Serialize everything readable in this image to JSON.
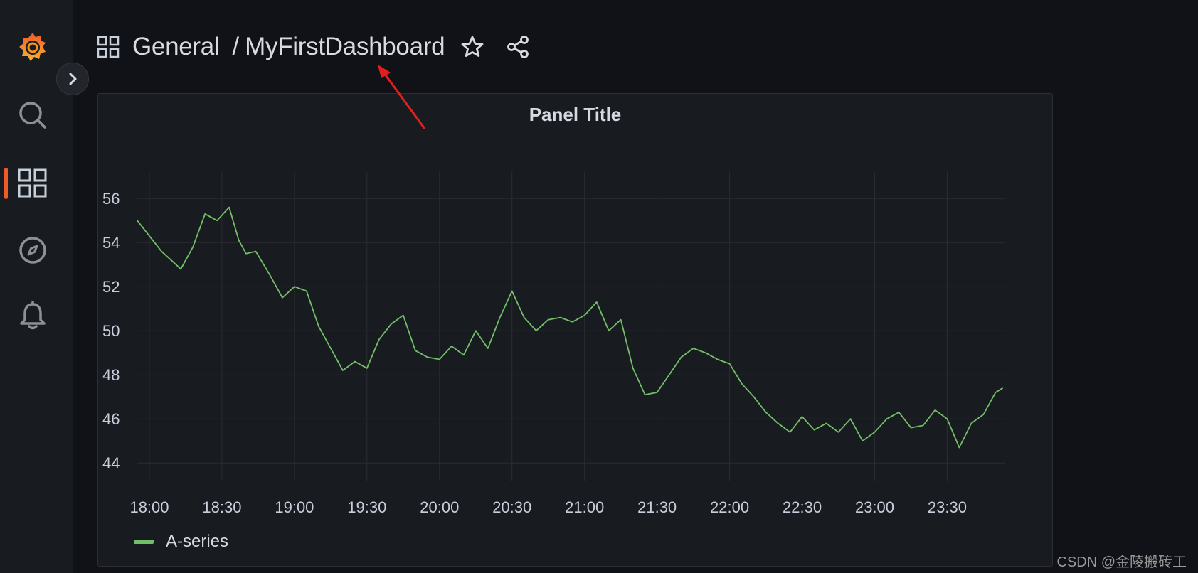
{
  "breadcrumb": {
    "folder": "General",
    "separator": "/",
    "dashboard": "MyFirstDashboard"
  },
  "sidebar": {
    "items": [
      {
        "name": "grafana-logo-icon"
      },
      {
        "name": "search-icon"
      },
      {
        "name": "dashboards-icon",
        "active": true
      },
      {
        "name": "explore-icon"
      },
      {
        "name": "alerting-bell-icon"
      }
    ]
  },
  "panel": {
    "title": "Panel Title",
    "legend": [
      {
        "label": "A-series",
        "color": "#73bf69"
      }
    ]
  },
  "chart_data": {
    "type": "line",
    "title": "Panel Title",
    "xlabel": "",
    "ylabel": "",
    "x_ticks": [
      "18:00",
      "18:30",
      "19:00",
      "19:30",
      "20:00",
      "20:30",
      "21:00",
      "21:30",
      "22:00",
      "22:30",
      "23:00",
      "23:30"
    ],
    "y_ticks": [
      44,
      46,
      48,
      50,
      52,
      56,
      54
    ],
    "ylim": [
      43.2,
      57.2
    ],
    "xlim_minutes": [
      1075,
      1434
    ],
    "grid": true,
    "legend_position": "bottom-left",
    "series": [
      {
        "name": "A-series",
        "color": "#73bf69",
        "x_minutes": [
          1075,
          1080,
          1085,
          1090,
          1093,
          1098,
          1103,
          1108,
          1113,
          1117,
          1120,
          1124,
          1130,
          1135,
          1140,
          1145,
          1150,
          1155,
          1160,
          1165,
          1170,
          1175,
          1180,
          1185,
          1190,
          1195,
          1200,
          1205,
          1210,
          1215,
          1220,
          1225,
          1230,
          1235,
          1240,
          1245,
          1250,
          1255,
          1260,
          1265,
          1270,
          1275,
          1280,
          1285,
          1290,
          1295,
          1300,
          1305,
          1310,
          1315,
          1320,
          1325,
          1330,
          1335,
          1340,
          1345,
          1350,
          1355,
          1360,
          1365,
          1370,
          1375,
          1380,
          1385,
          1390,
          1395,
          1400,
          1405,
          1410,
          1415,
          1420,
          1425,
          1430,
          1433
        ],
        "values": [
          55.0,
          54.3,
          53.6,
          53.1,
          52.8,
          53.8,
          55.3,
          55.0,
          55.6,
          54.1,
          53.5,
          53.6,
          52.5,
          51.5,
          52.0,
          51.8,
          50.2,
          49.2,
          48.2,
          48.6,
          48.3,
          49.6,
          50.3,
          50.7,
          49.1,
          48.8,
          48.7,
          49.3,
          48.9,
          50.0,
          49.2,
          50.6,
          51.8,
          50.6,
          50.0,
          50.5,
          50.6,
          50.4,
          50.7,
          51.3,
          50.0,
          50.5,
          48.3,
          47.1,
          47.2,
          48.0,
          48.8,
          49.2,
          49.0,
          48.7,
          48.5,
          47.6,
          47.0,
          46.3,
          45.8,
          45.4,
          46.1,
          45.5,
          45.8,
          45.4,
          46.0,
          45.0,
          45.4,
          46.0,
          46.3,
          45.6,
          45.7,
          46.4,
          46.0,
          44.7,
          45.8,
          46.2,
          47.2,
          47.4
        ]
      }
    ]
  },
  "watermark": "CSDN @金陵搬砖工"
}
